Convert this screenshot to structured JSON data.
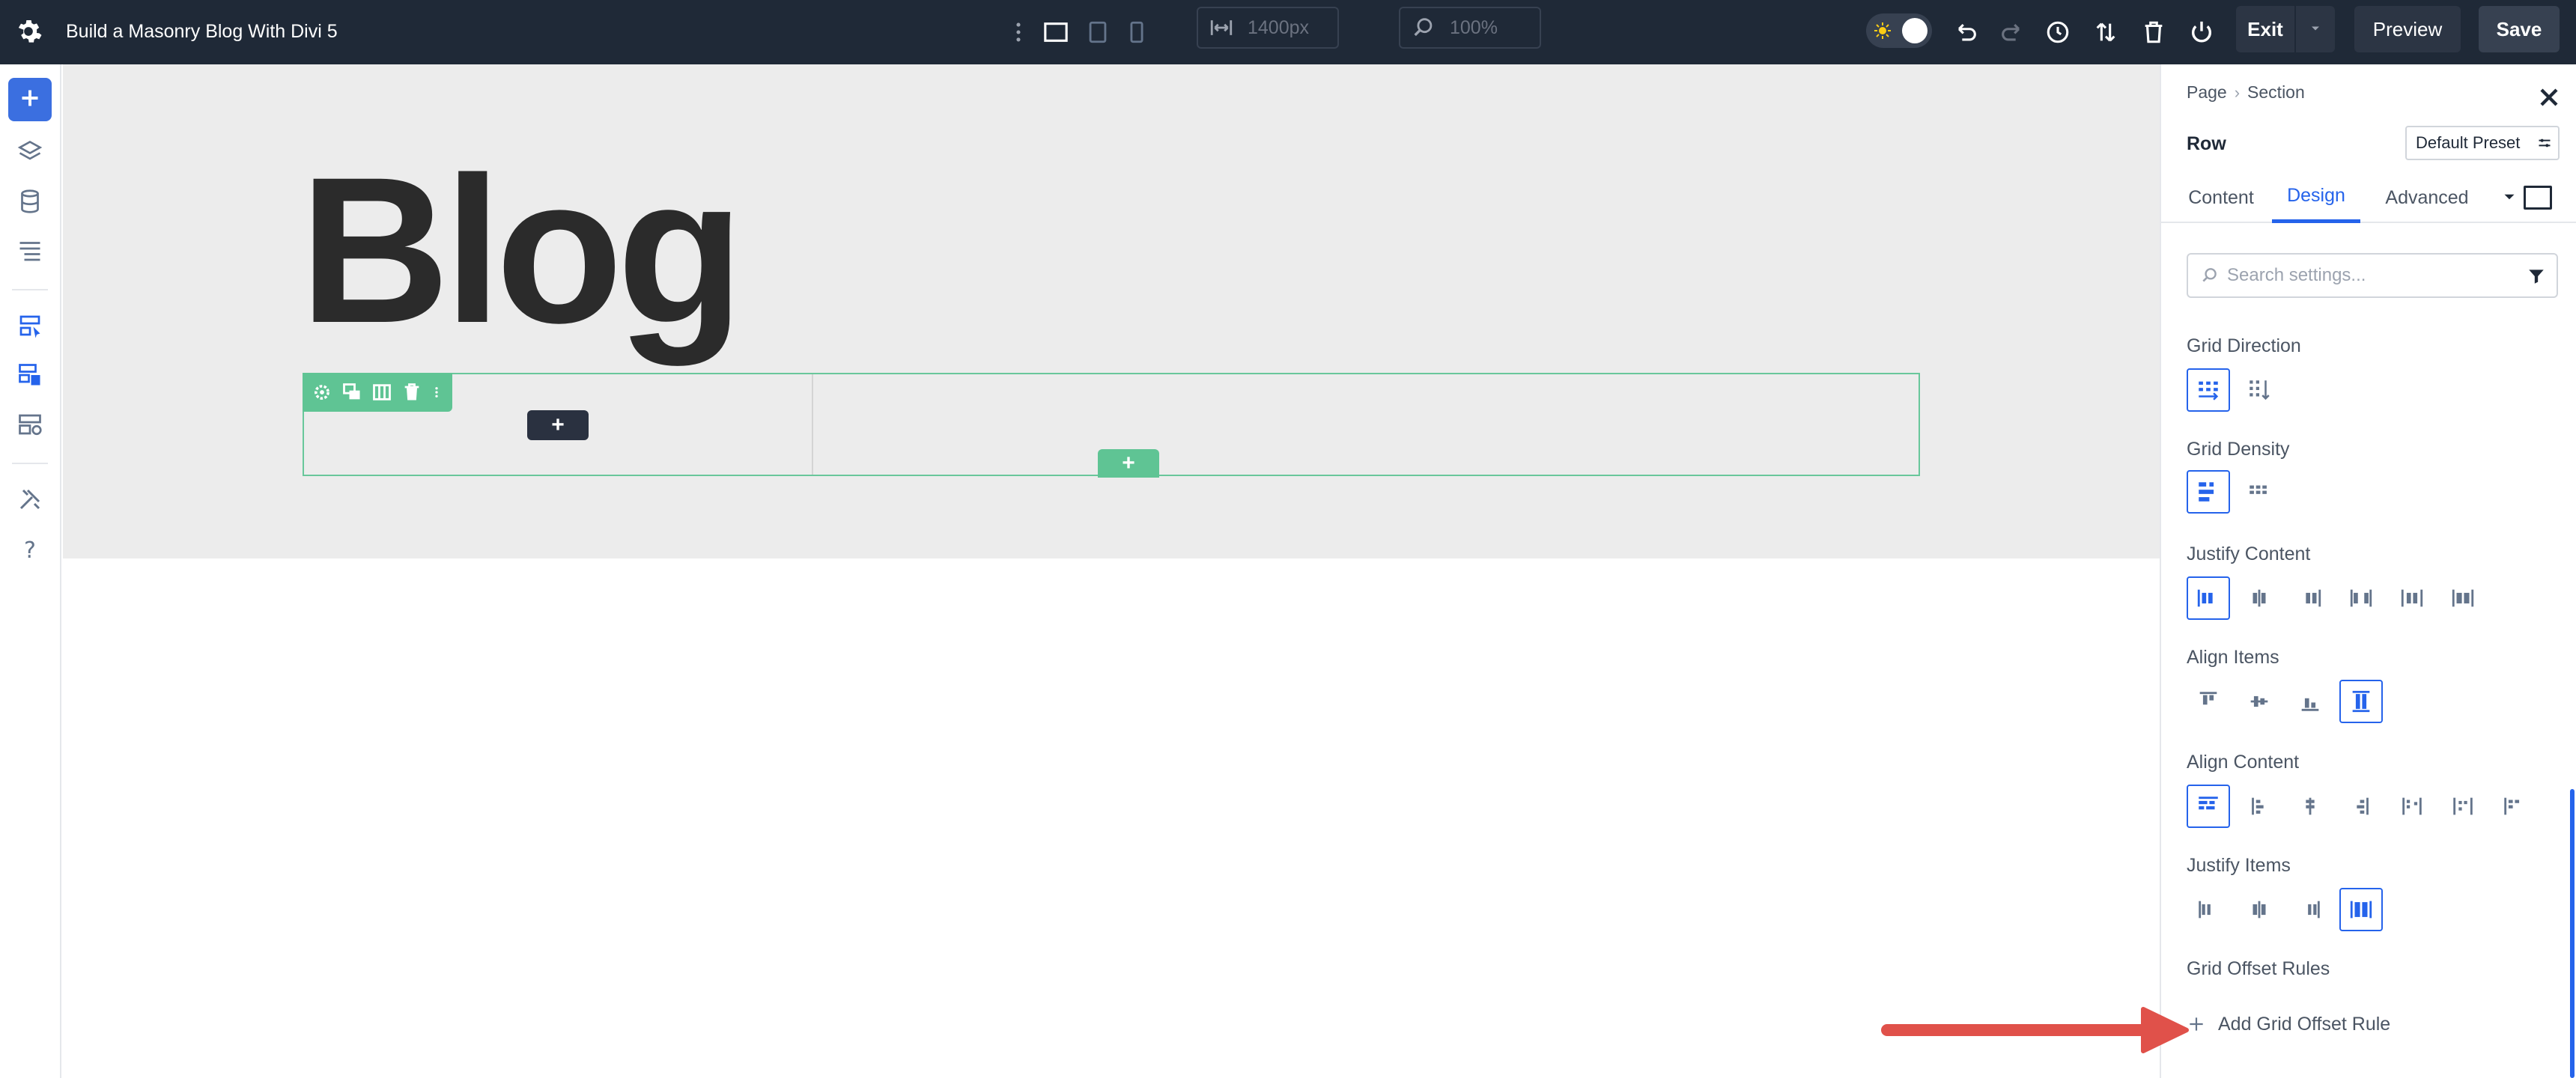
{
  "topbar": {
    "title": "Build a Masonry Blog With Divi 5",
    "width_value": "1400px",
    "zoom_value": "100%",
    "exit_label": "Exit",
    "preview_label": "Preview",
    "save_label": "Save",
    "icons": [
      "settings-gear-icon",
      "more-vertical-icon",
      "desktop-view-icon",
      "tablet-view-icon",
      "phone-view-icon",
      "width-icon",
      "zoom-icon",
      "theme-sun-icon",
      "undo-icon",
      "redo-icon",
      "history-icon",
      "sort-icon",
      "trash-icon",
      "power-icon",
      "caret-down-icon"
    ]
  },
  "leftbar": {
    "icons": [
      "add-icon",
      "layers-icon",
      "database-icon",
      "layout-icon",
      "builder-icon",
      "theme-builder-icon",
      "loop-icon",
      "tools-icon",
      "help-icon"
    ]
  },
  "canvas": {
    "heading": "Blog",
    "row_tools": [
      "gear-icon",
      "duplicate-icon",
      "columns-icon",
      "trash-icon",
      "more-icon"
    ],
    "add_module_label": "+",
    "add_row_label": "+"
  },
  "panel": {
    "breadcrumb": [
      "Page",
      "Section"
    ],
    "heading": "Row",
    "preset_label": "Default Preset",
    "tabs": [
      "Content",
      "Design",
      "Advanced"
    ],
    "active_tab": "Design",
    "search_placeholder": "Search settings...",
    "groups": [
      {
        "label": "Grid Direction",
        "options": 2,
        "selected": 0
      },
      {
        "label": "Grid Density",
        "options": 2,
        "selected": 0
      },
      {
        "label": "Justify Content",
        "options": 6,
        "selected": 0
      },
      {
        "label": "Align Items",
        "options": 4,
        "selected": 3
      },
      {
        "label": "Align Content",
        "options": 7,
        "selected": 0
      },
      {
        "label": "Justify Items",
        "options": 4,
        "selected": 3
      }
    ],
    "offset_label": "Grid Offset Rules",
    "add_rule_label": "Add Grid Offset Rule"
  },
  "colors": {
    "topbar": "#1f2937",
    "accent": "#2563eb",
    "row_green": "#5fc494",
    "annotation_arrow": "#e0514a"
  }
}
